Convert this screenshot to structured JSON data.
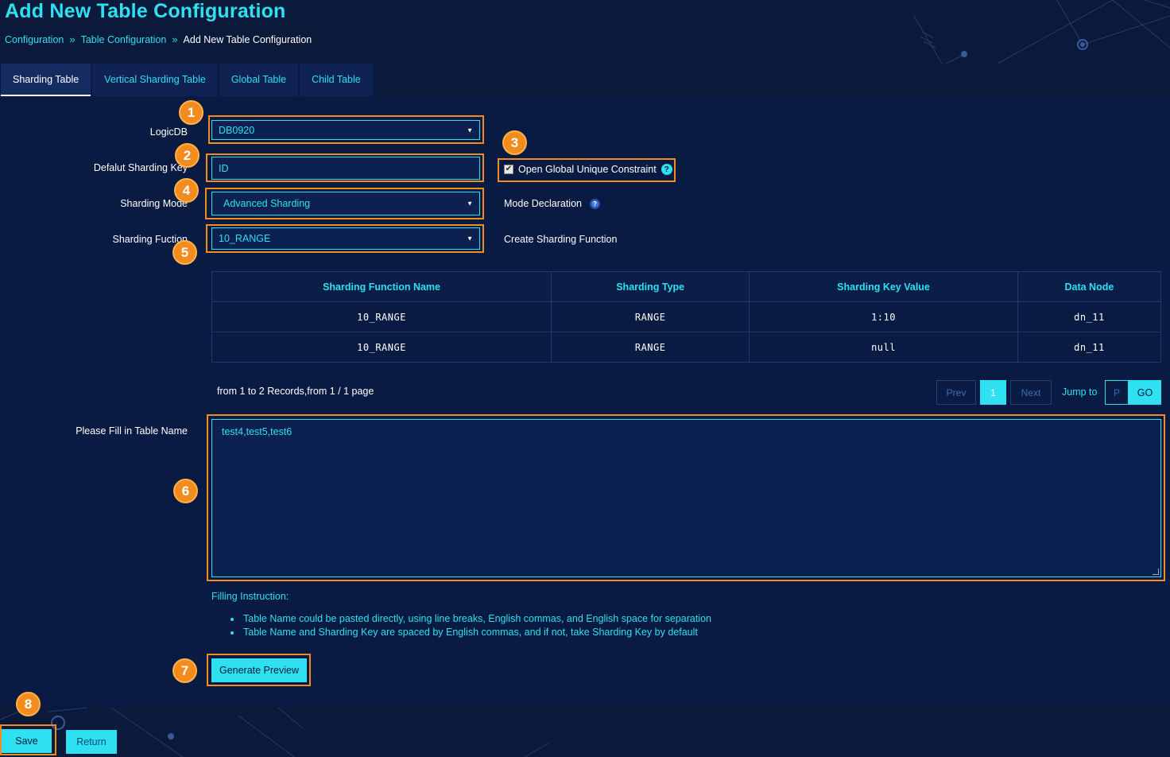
{
  "page": {
    "title": "Add New Table Configuration",
    "breadcrumb": [
      "Configuration",
      "Table Configuration",
      "Add New Table Configuration"
    ]
  },
  "tabs": [
    {
      "label": "Sharding Table",
      "active": true
    },
    {
      "label": "Vertical Sharding Table",
      "active": false
    },
    {
      "label": "Global Table",
      "active": false
    },
    {
      "label": "Child Table",
      "active": false
    }
  ],
  "form": {
    "logicdb": {
      "label": "LogicDB",
      "value": "DB0920"
    },
    "sharding_key": {
      "label": "Defalut Sharding Key",
      "value": "ID"
    },
    "global_unique": {
      "label": "Open Global Unique Constraint",
      "checked": true
    },
    "sharding_mode": {
      "label": "Sharding Mode",
      "value": "Advanced Sharding"
    },
    "mode_declaration": "Mode Declaration",
    "sharding_function": {
      "label": "Sharding Fuction",
      "value": "10_RANGE"
    },
    "create_function": "Create Sharding Function",
    "table_name": {
      "label": "Please Fill in Table Name",
      "value": "test4,test5,test6"
    }
  },
  "table": {
    "headers": [
      "Sharding Function Name",
      "Sharding Type",
      "Sharding Key Value",
      "Data Node"
    ],
    "rows": [
      [
        "10_RANGE",
        "RANGE",
        "1:10",
        "dn_11"
      ],
      [
        "10_RANGE",
        "RANGE",
        "null",
        "dn_11"
      ]
    ]
  },
  "pagination": {
    "info": "from 1 to 2 Records,from 1 / 1 page",
    "prev": "Prev",
    "current": "1",
    "next": "Next",
    "jump_label": "Jump to",
    "jump_placeholder": "P",
    "go": "GO"
  },
  "instructions": {
    "title": "Filling Instruction:",
    "items": [
      "Table Name could be pasted directly, using line breaks, English commas, and English space for separation",
      "Table Name and Sharding Key are spaced by English commas, and if not, take Sharding Key by default"
    ]
  },
  "buttons": {
    "generate_preview": "Generate Preview",
    "save": "Save",
    "return": "Return"
  },
  "badges": [
    "1",
    "2",
    "3",
    "4",
    "5",
    "6",
    "7",
    "8"
  ],
  "icons": {
    "help": "question-circle-icon",
    "caret": "caret-down-icon",
    "breadcrumb_sep": "double-chevron-right-icon"
  },
  "colors": {
    "accent": "#2ee0f0",
    "highlight": "#f28c1f",
    "background": "#0b1a3b"
  }
}
